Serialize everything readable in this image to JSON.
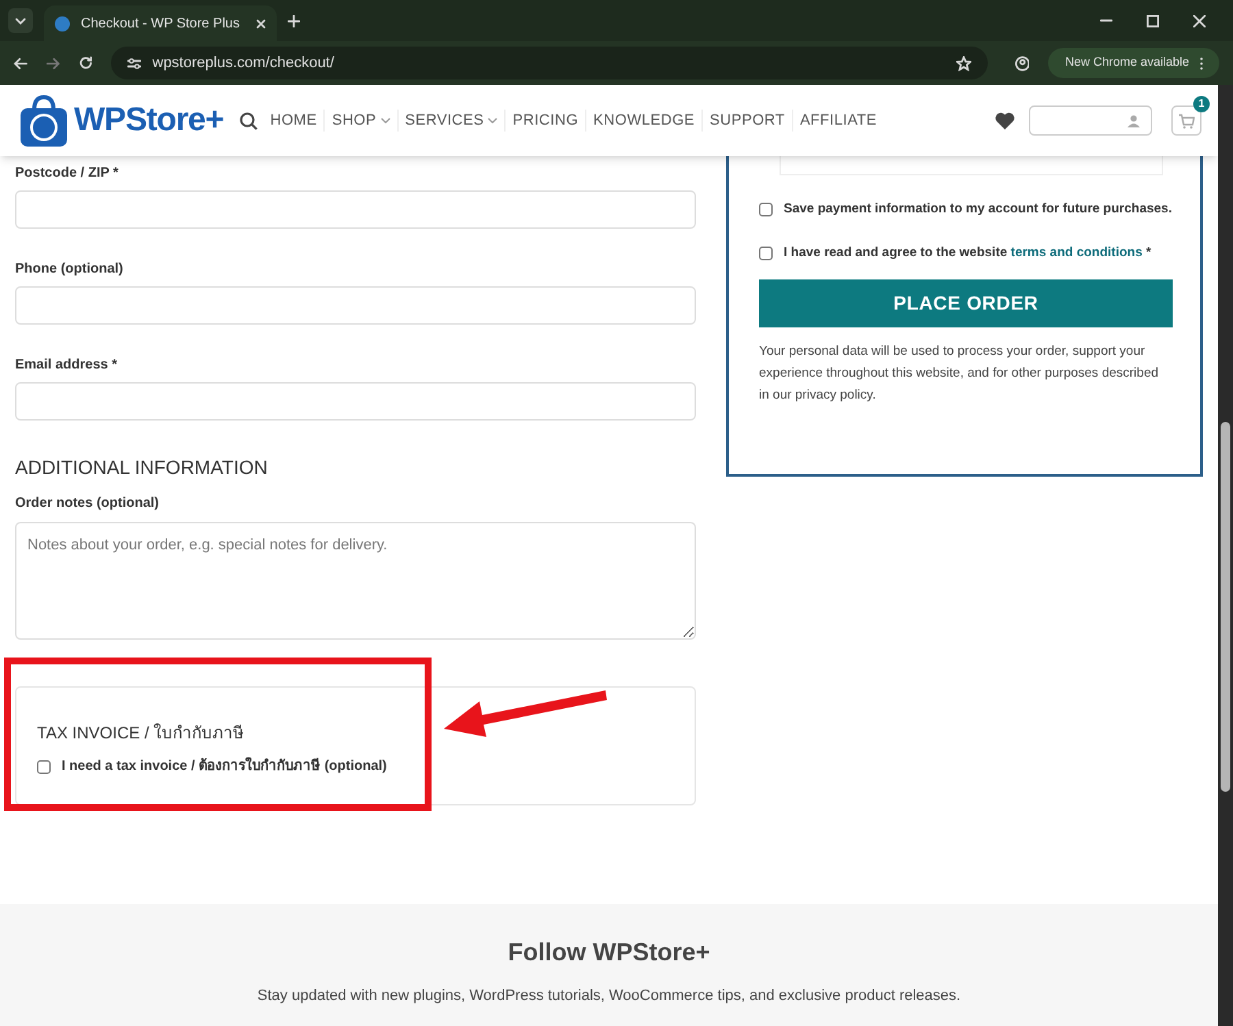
{
  "browser": {
    "tab_title": "Checkout - WP Store Plus",
    "url": "wpstoreplus.com/checkout/",
    "update_button": "New Chrome available"
  },
  "header": {
    "logo": "WPStore+",
    "nav": [
      {
        "label": "HOME",
        "dropdown": false
      },
      {
        "label": "SHOP",
        "dropdown": true
      },
      {
        "label": "SERVICES",
        "dropdown": true
      },
      {
        "label": "PRICING",
        "dropdown": false
      },
      {
        "label": "KNOWLEDGE",
        "dropdown": false
      },
      {
        "label": "SUPPORT",
        "dropdown": false
      },
      {
        "label": "AFFILIATE",
        "dropdown": false
      }
    ],
    "cart_count": "1"
  },
  "fields": [
    {
      "label": "Postcode / ZIP *"
    },
    {
      "label": "Phone (optional)"
    },
    {
      "label": "Email address *"
    }
  ],
  "additional": {
    "heading": "ADDITIONAL INFORMATION",
    "label": "Order notes (optional)",
    "placeholder": "Notes about your order, e.g. special notes for delivery."
  },
  "tax_invoice": {
    "title": "TAX INVOICE / ใบกำกับภาษี",
    "label": "I need a tax invoice / ต้องการใบกำกับภาษี (optional)",
    "checked": false
  },
  "payment": {
    "checkboxes": [
      {
        "text": "Save payment information to my account for future purchases.",
        "checked": false
      },
      {
        "text": "I have read and agree to the website",
        "link": "terms and conditions",
        "suffix": "*",
        "checked": false
      }
    ],
    "button": "PLACE ORDER",
    "note": "Your personal data will be used to process your order, support your experience throughout this website, and for other purposes described in our privacy policy."
  },
  "footer": {
    "title": "Follow WPStore+",
    "text": "Stay updated with new plugins, WordPress tutorials, WooCommerce tips, and exclusive product releases."
  }
}
